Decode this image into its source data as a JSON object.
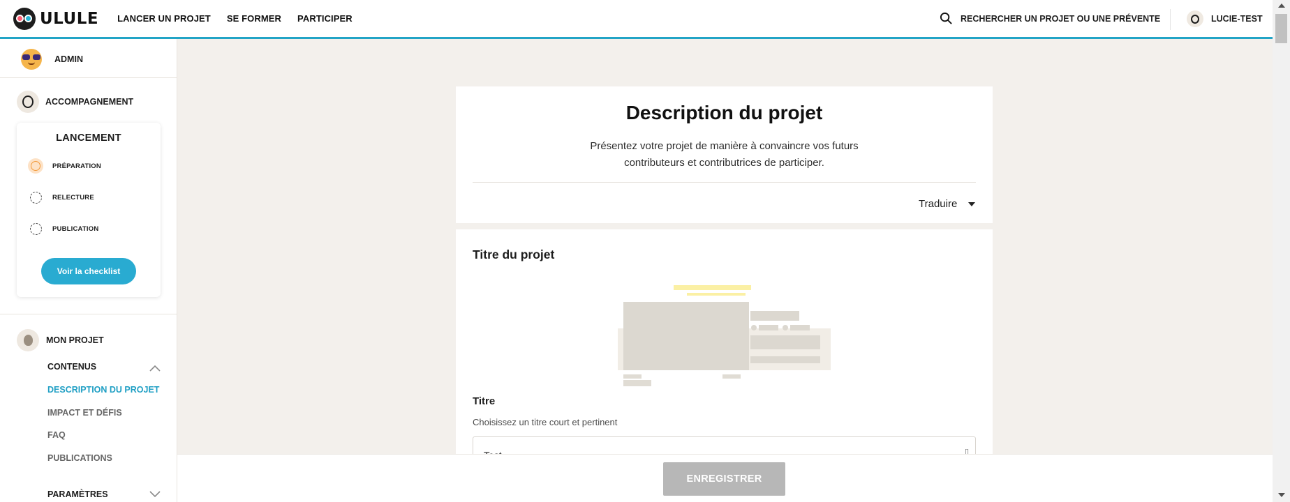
{
  "header": {
    "logo_text": "ULULE",
    "nav": [
      "LANCER UN PROJET",
      "SE FORMER",
      "PARTICIPER"
    ],
    "search_label": "RECHERCHER UN PROJET OU UNE PRÉVENTE",
    "user_name": "LUCIE-TEST",
    "accent_color": "#22a4c6"
  },
  "sidebar": {
    "admin_label": "ADMIN",
    "accompaniment_label": "ACCOMPAGNEMENT",
    "launch": {
      "title": "LANCEMENT",
      "steps": [
        {
          "label": "PRÉPARATION",
          "state": "in-progress"
        },
        {
          "label": "RELECTURE",
          "state": "pending"
        },
        {
          "label": "PUBLICATION",
          "state": "pending"
        }
      ],
      "checklist_button": "Voir la checklist"
    },
    "project_label": "MON PROJET",
    "contents_label": "CONTENUS",
    "contents_items": [
      "DESCRIPTION DU PROJET",
      "IMPACT ET DÉFIS",
      "FAQ",
      "PUBLICATIONS"
    ],
    "active_item": "DESCRIPTION DU PROJET",
    "settings_label": "PARAMÈTRES"
  },
  "main": {
    "title": "Description du projet",
    "subtitle": "Présentez votre projet de manière à convaincre vos futurs contributeurs et contributrices de participer.",
    "translate_label": "Traduire",
    "section_title": "Titre du projet",
    "field_label": "Titre",
    "field_help": "Choisissez un titre court et pertinent",
    "field_value": "Test"
  },
  "footer": {
    "save_button": "ENREGISTRER"
  }
}
